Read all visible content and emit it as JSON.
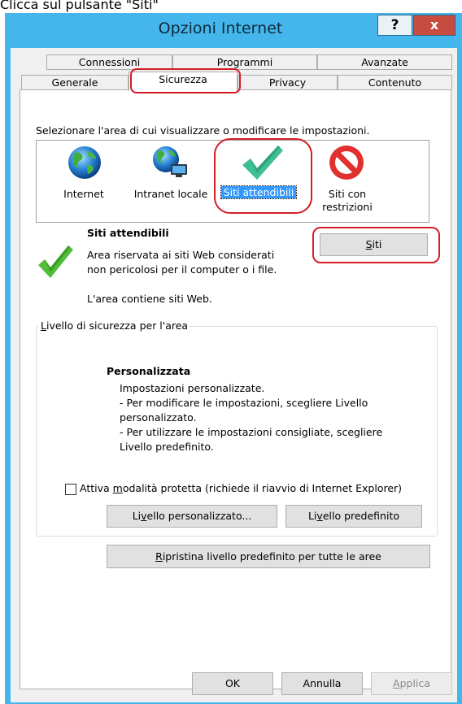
{
  "instruction": "Clicca sul pulsante \"Siti\"",
  "window": {
    "title": "Opzioni Internet",
    "help_symbol": "?",
    "close_symbol": "x"
  },
  "tabs": {
    "row1": [
      "Connessioni",
      "Programmi",
      "Avanzate"
    ],
    "row2": [
      "Generale",
      "Sicurezza",
      "Privacy",
      "Contenuto"
    ],
    "active": "Sicurezza"
  },
  "security": {
    "zones_prompt": "Selezionare l'area di cui visualizzare o modificare le impostazioni.",
    "zones": [
      {
        "label": "Internet",
        "icon": "globe-icon"
      },
      {
        "label": "Intranet locale",
        "icon": "intranet-globe-icon"
      },
      {
        "label": "Siti attendibili",
        "icon": "checkmark-icon",
        "selected": true
      },
      {
        "label_line1": "Siti con",
        "label_line2": "restrizioni",
        "icon": "no-entry-icon"
      }
    ],
    "selected_zone": {
      "title": "Siti attendibili",
      "desc_line1": "Area riservata ai siti Web considerati",
      "desc_line2": "non pericolosi per il computer o i file.",
      "contains": "L'area contiene siti Web."
    },
    "sites_button": {
      "mnemonic": "S",
      "rest": "iti"
    },
    "level_group": {
      "legend_mnemonic": "L",
      "legend_rest": "ivello di sicurezza per l'area",
      "level_name": "Personalizzata",
      "lines": [
        "Impostazioni personalizzate.",
        "- Per modificare le impostazioni, scegliere Livello",
        "personalizzato.",
        "- Per utilizzare le impostazioni consigliate, scegliere",
        "Livello predefinito."
      ],
      "protected_mode": {
        "prefix": "Attiva ",
        "mnemonic": "m",
        "rest": "odalità protetta (richiede il riavvio di Internet Explorer)",
        "checked": false
      },
      "custom_button": {
        "prefix": "Li",
        "mnemonic": "v",
        "rest": "ello personalizzato..."
      },
      "default_button": {
        "prefix": "Li",
        "mnemonic": "v",
        "rest": "ello predefinito"
      }
    },
    "reset_button": {
      "mnemonic": "R",
      "rest": "ipristina livello predefinito per tutte le aree"
    }
  },
  "footer": {
    "ok": "OK",
    "cancel": "Annulla",
    "apply_mnemonic": "A",
    "apply_rest": "pplica"
  },
  "colors": {
    "window_frame": "#45b6ec",
    "close_button": "#c74b3f",
    "selection": "#3399ff",
    "highlight_oval": "#d61c27"
  }
}
